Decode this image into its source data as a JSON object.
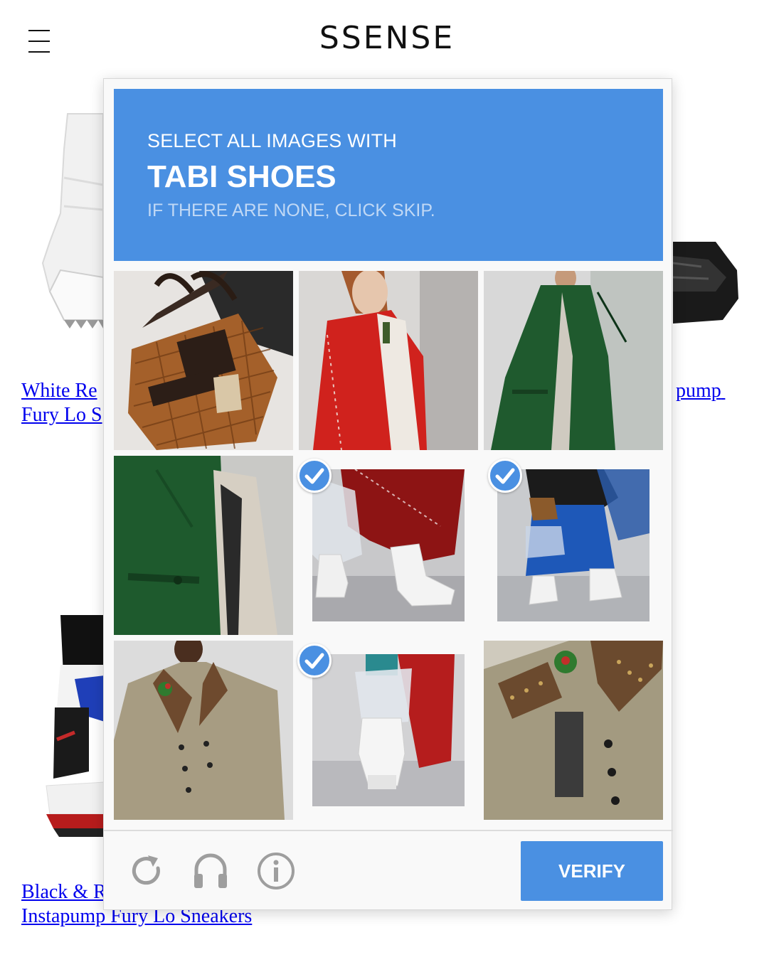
{
  "header": {
    "brand": "SSENSE"
  },
  "products": [
    {
      "title_line1": "White Re",
      "title_line2": "Fury Lo S"
    },
    {
      "title_fragment": "pump"
    },
    {
      "title_line1": "Black & R",
      "title_line2": "Instapump Fury Lo Sneakers"
    }
  ],
  "captcha": {
    "instruction": "SELECT ALL IMAGES WITH",
    "target": "TABI SHOES",
    "hint": "IF THERE ARE NONE, CLICK SKIP.",
    "tiles": [
      {
        "subject": "wicker-bag",
        "selected": false
      },
      {
        "subject": "red-coat-model",
        "selected": false
      },
      {
        "subject": "green-trench-coat",
        "selected": false
      },
      {
        "subject": "green-coat-detail",
        "selected": false
      },
      {
        "subject": "white-tabi-boots-red-coat",
        "selected": true
      },
      {
        "subject": "blue-skirt-white-boots",
        "selected": true
      },
      {
        "subject": "tweed-coat-model",
        "selected": false
      },
      {
        "subject": "white-tabi-boot-closeup",
        "selected": true
      },
      {
        "subject": "tweed-coat-detail",
        "selected": false
      }
    ],
    "icons": [
      "refresh-icon",
      "headphones-icon",
      "info-icon"
    ],
    "verify_label": "VERIFY",
    "colors": {
      "accent": "#4a90e2",
      "background": "#f9f9f9"
    }
  }
}
